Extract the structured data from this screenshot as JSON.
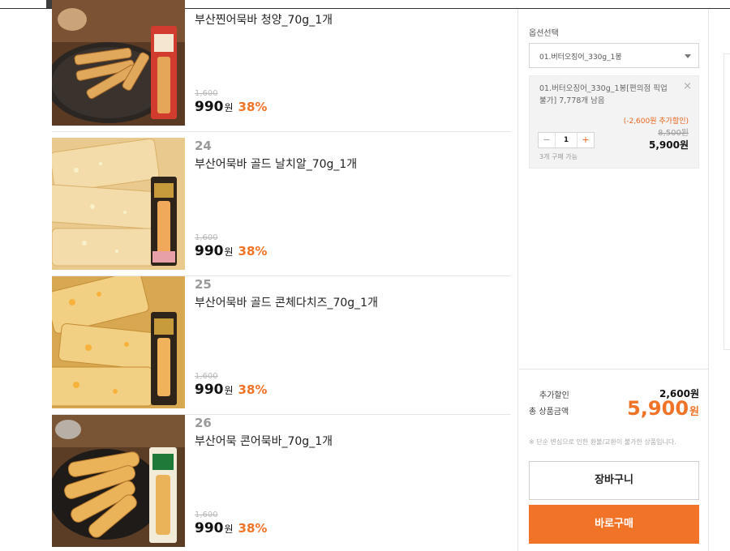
{
  "products": [
    {
      "number": "",
      "name": "부산찐어묵바 청양_70g_1개",
      "original_price": "1,600원",
      "price": "990",
      "currency": "원",
      "discount": "38%"
    },
    {
      "number": "24",
      "name": "부산어묵바 골드 날치알_70g_1개",
      "original_price": "1,600원",
      "price": "990",
      "currency": "원",
      "discount": "38%"
    },
    {
      "number": "25",
      "name": "부산어묵바 골드 콘체다치즈_70g_1개",
      "original_price": "1,600원",
      "price": "990",
      "currency": "원",
      "discount": "38%"
    },
    {
      "number": "26",
      "name": "부산어묵 콘어묵바_70g_1개",
      "original_price": "1,600원",
      "price": "990",
      "currency": "원",
      "discount": "38%"
    }
  ],
  "options": {
    "label": "옵션선택",
    "selected_value": "01.버터오징어_330g_1봉",
    "selected_item": {
      "name": "01.버터오징어_330g_1봉[편의점 픽업 불가] 7,778개 남음",
      "extra_discount": "(-2,600원 추가할인)",
      "original_price": "8,500원",
      "price": "5,900원",
      "quantity": "1",
      "minus": "−",
      "plus": "+",
      "purchase_note": "3개 구매 가능",
      "close": "×"
    }
  },
  "summary": {
    "extra_discount_label": "추가할인",
    "extra_discount_value": "2,600원",
    "total_label": "총 상품금액",
    "total_value": "5,900",
    "total_unit": "원",
    "notice": "※ 단순 변심으로 인한 환불/교환이 불가한 상품입니다."
  },
  "actions": {
    "cart": "장바구니",
    "buy": "바로구매"
  },
  "colors": {
    "accent": "#f07328",
    "discount_text": "#e8651d"
  }
}
